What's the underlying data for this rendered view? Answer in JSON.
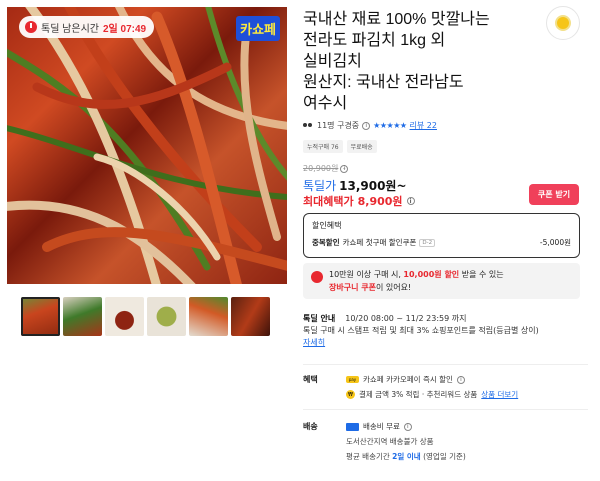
{
  "image": {
    "timer_label": "톡딜 남은시간",
    "timer_value": "2일 07:49",
    "brand_badge": "카쇼페"
  },
  "thumbnails": [
    "thumb-1",
    "thumb-2",
    "thumb-3",
    "thumb-4",
    "thumb-5",
    "thumb-6"
  ],
  "product": {
    "title_lines": [
      "국내산 재료 100% 맛깔나는",
      "전라도 파김치 1kg 외",
      "실비김치",
      "원산지: 국내산 전라남도",
      "여수시"
    ],
    "purchase_intro": "11명 구경중",
    "stars": "★★★★★",
    "review_link": "리뷰 22",
    "tags": [
      "누적구매 76",
      "무료배송"
    ],
    "original_price": "20,900원",
    "deal_label": "톡딜가",
    "deal_price": "13,900원~",
    "best_label": "최대혜택가",
    "best_price": "8,900원",
    "coupon_button": "쿠폰 받기"
  },
  "discount": {
    "title": "할인혜택",
    "label": "중복할인",
    "description": "카쇼페 첫구매 할인쿠폰",
    "badge": "D-2",
    "amount": "-5,000원"
  },
  "cart_banner": {
    "line1_a": "10만원 이상 구매 시, ",
    "line1_b": "10,000원 할인",
    "line1_c": " 받을 수 있는",
    "line2_a": "장바구니 쿠폰",
    "line2_b": "이 있어요!"
  },
  "notice": {
    "label": "톡딜 안내",
    "period": "10/20 08:00 ~ 11/2 23:59 까지",
    "text": "톡딜 구매 시 스탬프 적립 및 최대 3% 쇼핑포인트를 적립(등급별 상이)",
    "link": "자세히"
  },
  "benefit": {
    "label": "혜택",
    "pay_text": "카쇼페 카카오페이 즉시 할인",
    "point_text_a": "결제 금액 3% 적립 · 추천리워드 상품 ",
    "point_link": "상품 더보기"
  },
  "shipping": {
    "label": "배송",
    "fee": "배송비 무료",
    "region": "도서산간지역 배송불가 상품",
    "period_a": "평균 배송기간 ",
    "period_b": "2일 이내",
    "period_c": " (영업일 기준)"
  }
}
